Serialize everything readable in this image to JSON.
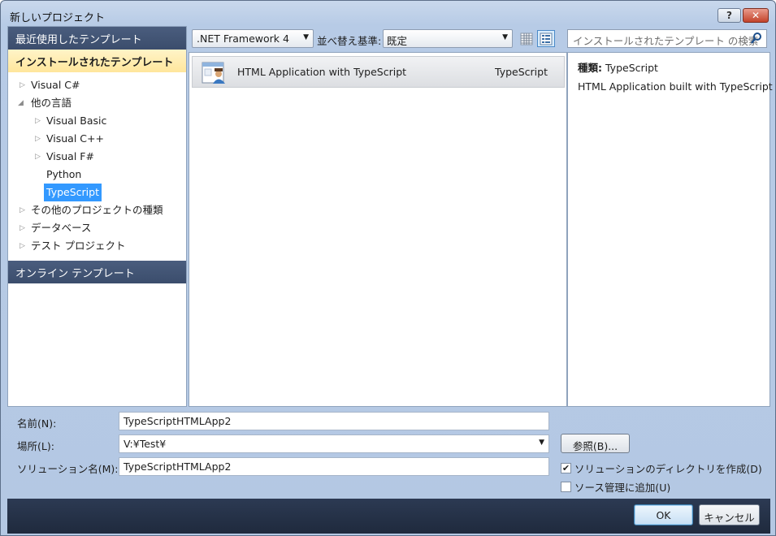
{
  "window": {
    "title": "新しいプロジェクト",
    "help_glyph": "?",
    "close_glyph": "✕"
  },
  "left": {
    "recent_header": "最近使用したテンプレート",
    "installed_header": "インストールされたテンプレート",
    "online_header": "オンライン テンプレート",
    "tree": [
      {
        "label": "Visual C#",
        "expander": "▷"
      },
      {
        "label": "他の言語",
        "expander": "◢"
      },
      {
        "label": "Visual Basic",
        "expander": "▷"
      },
      {
        "label": "Visual C++",
        "expander": "▷"
      },
      {
        "label": "Visual F#",
        "expander": "▷"
      },
      {
        "label": "Python",
        "expander": ""
      },
      {
        "label": "TypeScript",
        "expander": ""
      },
      {
        "label": "その他のプロジェクトの種類",
        "expander": "▷"
      },
      {
        "label": "データベース",
        "expander": "▷"
      },
      {
        "label": "テスト プロジェクト",
        "expander": "▷"
      }
    ]
  },
  "toolbar": {
    "framework": ".NET Framework 4",
    "sort_label": "並べ替え基準:",
    "sort_value": "既定",
    "search_placeholder": "インストールされたテンプレート の検索"
  },
  "templates": [
    {
      "name": "HTML Application with TypeScript",
      "language": "TypeScript",
      "icon": "html-app-icon"
    }
  ],
  "details": {
    "type_key": "種類:",
    "type_value": "TypeScript",
    "description": "HTML Application built with TypeScript"
  },
  "form": {
    "name_label": "名前(N):",
    "name_value": "TypeScriptHTMLApp2",
    "location_label": "場所(L):",
    "location_value": "V:¥Test¥",
    "solution_label": "ソリューション名(M):",
    "solution_value": "TypeScriptHTMLApp2",
    "browse_label": "参照(B)...",
    "create_dir_label": "ソリューションのディレクトリを作成(D)",
    "create_dir_checked": true,
    "source_control_label": "ソース管理に追加(U)",
    "source_control_checked": false
  },
  "buttons": {
    "ok": "OK",
    "cancel": "キャンセル"
  },
  "colors": {
    "selection": "#3399ff",
    "header_dark": "#3b4d6c",
    "installed_bg": "#ffe69c"
  }
}
